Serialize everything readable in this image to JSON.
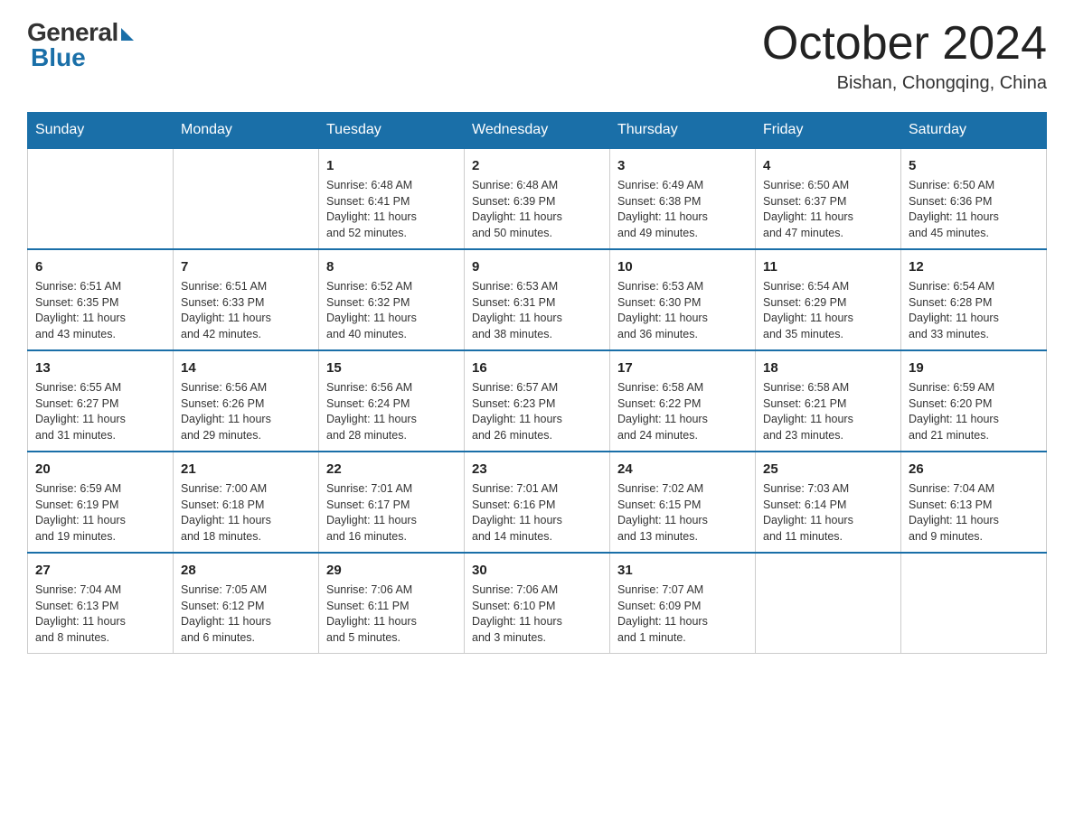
{
  "header": {
    "logo_general": "General",
    "logo_blue": "Blue",
    "month_title": "October 2024",
    "location": "Bishan, Chongqing, China"
  },
  "days_header": [
    "Sunday",
    "Monday",
    "Tuesday",
    "Wednesday",
    "Thursday",
    "Friday",
    "Saturday"
  ],
  "weeks": [
    [
      {
        "day": "",
        "info": ""
      },
      {
        "day": "",
        "info": ""
      },
      {
        "day": "1",
        "info": "Sunrise: 6:48 AM\nSunset: 6:41 PM\nDaylight: 11 hours\nand 52 minutes."
      },
      {
        "day": "2",
        "info": "Sunrise: 6:48 AM\nSunset: 6:39 PM\nDaylight: 11 hours\nand 50 minutes."
      },
      {
        "day": "3",
        "info": "Sunrise: 6:49 AM\nSunset: 6:38 PM\nDaylight: 11 hours\nand 49 minutes."
      },
      {
        "day": "4",
        "info": "Sunrise: 6:50 AM\nSunset: 6:37 PM\nDaylight: 11 hours\nand 47 minutes."
      },
      {
        "day": "5",
        "info": "Sunrise: 6:50 AM\nSunset: 6:36 PM\nDaylight: 11 hours\nand 45 minutes."
      }
    ],
    [
      {
        "day": "6",
        "info": "Sunrise: 6:51 AM\nSunset: 6:35 PM\nDaylight: 11 hours\nand 43 minutes."
      },
      {
        "day": "7",
        "info": "Sunrise: 6:51 AM\nSunset: 6:33 PM\nDaylight: 11 hours\nand 42 minutes."
      },
      {
        "day": "8",
        "info": "Sunrise: 6:52 AM\nSunset: 6:32 PM\nDaylight: 11 hours\nand 40 minutes."
      },
      {
        "day": "9",
        "info": "Sunrise: 6:53 AM\nSunset: 6:31 PM\nDaylight: 11 hours\nand 38 minutes."
      },
      {
        "day": "10",
        "info": "Sunrise: 6:53 AM\nSunset: 6:30 PM\nDaylight: 11 hours\nand 36 minutes."
      },
      {
        "day": "11",
        "info": "Sunrise: 6:54 AM\nSunset: 6:29 PM\nDaylight: 11 hours\nand 35 minutes."
      },
      {
        "day": "12",
        "info": "Sunrise: 6:54 AM\nSunset: 6:28 PM\nDaylight: 11 hours\nand 33 minutes."
      }
    ],
    [
      {
        "day": "13",
        "info": "Sunrise: 6:55 AM\nSunset: 6:27 PM\nDaylight: 11 hours\nand 31 minutes."
      },
      {
        "day": "14",
        "info": "Sunrise: 6:56 AM\nSunset: 6:26 PM\nDaylight: 11 hours\nand 29 minutes."
      },
      {
        "day": "15",
        "info": "Sunrise: 6:56 AM\nSunset: 6:24 PM\nDaylight: 11 hours\nand 28 minutes."
      },
      {
        "day": "16",
        "info": "Sunrise: 6:57 AM\nSunset: 6:23 PM\nDaylight: 11 hours\nand 26 minutes."
      },
      {
        "day": "17",
        "info": "Sunrise: 6:58 AM\nSunset: 6:22 PM\nDaylight: 11 hours\nand 24 minutes."
      },
      {
        "day": "18",
        "info": "Sunrise: 6:58 AM\nSunset: 6:21 PM\nDaylight: 11 hours\nand 23 minutes."
      },
      {
        "day": "19",
        "info": "Sunrise: 6:59 AM\nSunset: 6:20 PM\nDaylight: 11 hours\nand 21 minutes."
      }
    ],
    [
      {
        "day": "20",
        "info": "Sunrise: 6:59 AM\nSunset: 6:19 PM\nDaylight: 11 hours\nand 19 minutes."
      },
      {
        "day": "21",
        "info": "Sunrise: 7:00 AM\nSunset: 6:18 PM\nDaylight: 11 hours\nand 18 minutes."
      },
      {
        "day": "22",
        "info": "Sunrise: 7:01 AM\nSunset: 6:17 PM\nDaylight: 11 hours\nand 16 minutes."
      },
      {
        "day": "23",
        "info": "Sunrise: 7:01 AM\nSunset: 6:16 PM\nDaylight: 11 hours\nand 14 minutes."
      },
      {
        "day": "24",
        "info": "Sunrise: 7:02 AM\nSunset: 6:15 PM\nDaylight: 11 hours\nand 13 minutes."
      },
      {
        "day": "25",
        "info": "Sunrise: 7:03 AM\nSunset: 6:14 PM\nDaylight: 11 hours\nand 11 minutes."
      },
      {
        "day": "26",
        "info": "Sunrise: 7:04 AM\nSunset: 6:13 PM\nDaylight: 11 hours\nand 9 minutes."
      }
    ],
    [
      {
        "day": "27",
        "info": "Sunrise: 7:04 AM\nSunset: 6:13 PM\nDaylight: 11 hours\nand 8 minutes."
      },
      {
        "day": "28",
        "info": "Sunrise: 7:05 AM\nSunset: 6:12 PM\nDaylight: 11 hours\nand 6 minutes."
      },
      {
        "day": "29",
        "info": "Sunrise: 7:06 AM\nSunset: 6:11 PM\nDaylight: 11 hours\nand 5 minutes."
      },
      {
        "day": "30",
        "info": "Sunrise: 7:06 AM\nSunset: 6:10 PM\nDaylight: 11 hours\nand 3 minutes."
      },
      {
        "day": "31",
        "info": "Sunrise: 7:07 AM\nSunset: 6:09 PM\nDaylight: 11 hours\nand 1 minute."
      },
      {
        "day": "",
        "info": ""
      },
      {
        "day": "",
        "info": ""
      }
    ]
  ]
}
